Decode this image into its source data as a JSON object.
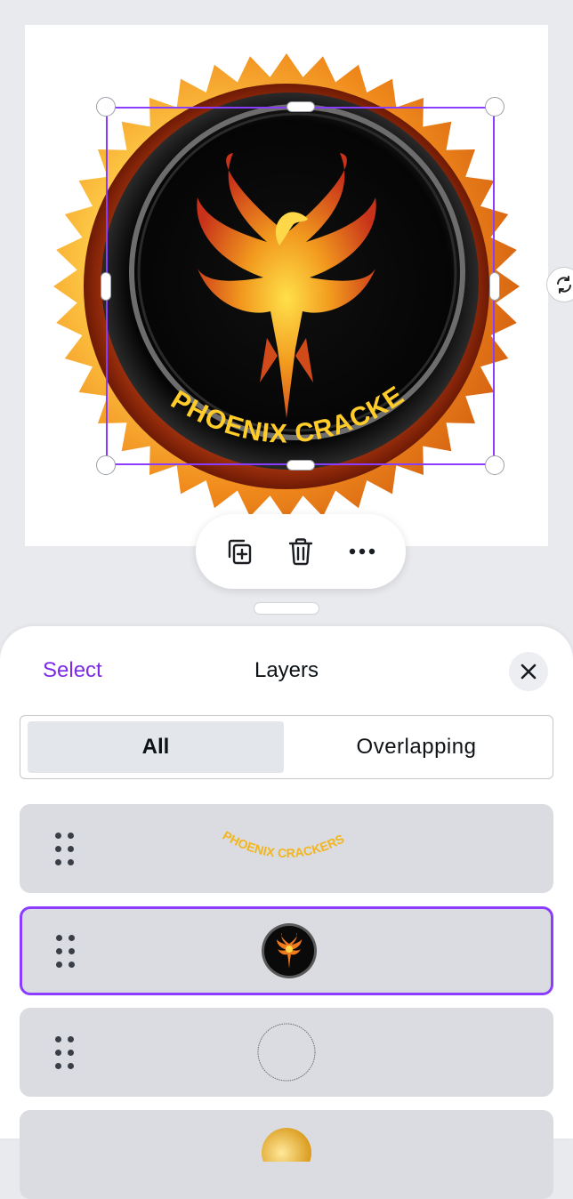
{
  "canvas": {
    "logo_text": "PHOENIX   CRACKERS",
    "colors": {
      "selection": "#8b3dff",
      "accent_text": "#7d2ae8"
    }
  },
  "context_toolbar": {
    "items": [
      {
        "icon": "duplicate-icon"
      },
      {
        "icon": "trash-icon"
      },
      {
        "icon": "more-icon"
      }
    ]
  },
  "rotate": {
    "icon": "rotate-icon"
  },
  "layers_panel": {
    "select_label": "Select",
    "title": "Layers",
    "close_icon": "close-icon",
    "tabs": [
      {
        "label": "All",
        "active": true
      },
      {
        "label": "Overlapping",
        "active": false
      }
    ],
    "layers": [
      {
        "type": "text",
        "preview_text": "PHOENIX   CRACKERS",
        "selected": false
      },
      {
        "type": "image",
        "preview": "phoenix-logo-circle",
        "selected": true
      },
      {
        "type": "shape",
        "preview": "empty-circle",
        "selected": false
      },
      {
        "type": "shape",
        "preview": "gold-badge",
        "selected": false
      }
    ]
  }
}
